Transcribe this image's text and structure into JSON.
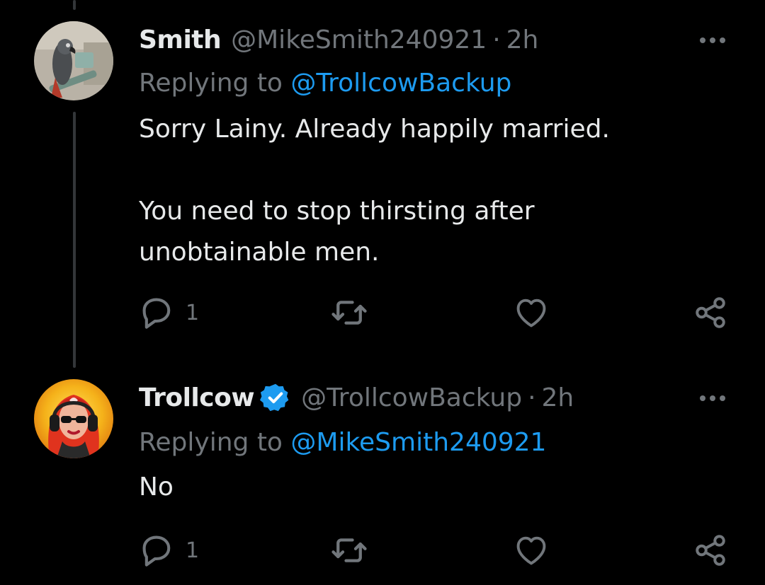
{
  "tweets": [
    {
      "name": "Smith",
      "handle": "@MikeSmith240921",
      "separator": "·",
      "time": "2h",
      "verified": false,
      "replying_prefix": "Replying to ",
      "replying_to": "@TrollcowBackup",
      "text": "Sorry Lainy. Already happily married.\n\nYou need to stop thirsting after\nunobtainable men.",
      "reply_count": "1",
      "avatar_icon": "parrot-avatar"
    },
    {
      "name": "Trollcow",
      "handle": "@TrollcowBackup",
      "separator": "·",
      "time": "2h",
      "verified": true,
      "replying_prefix": "Replying to ",
      "replying_to": "@MikeSmith240921",
      "text": "No",
      "reply_count": "1",
      "avatar_icon": "headphones-woman-avatar"
    }
  ],
  "icons": {
    "reply": "reply-icon",
    "retweet": "retweet-icon",
    "like": "heart-icon",
    "share": "share-icon",
    "more": "more-options-icon",
    "verified": "verified-badge-icon"
  },
  "colors": {
    "background": "#000000",
    "text_primary": "#e7e9ea",
    "text_secondary": "#71767b",
    "accent": "#1d9bf0",
    "thread_line": "#333639"
  }
}
